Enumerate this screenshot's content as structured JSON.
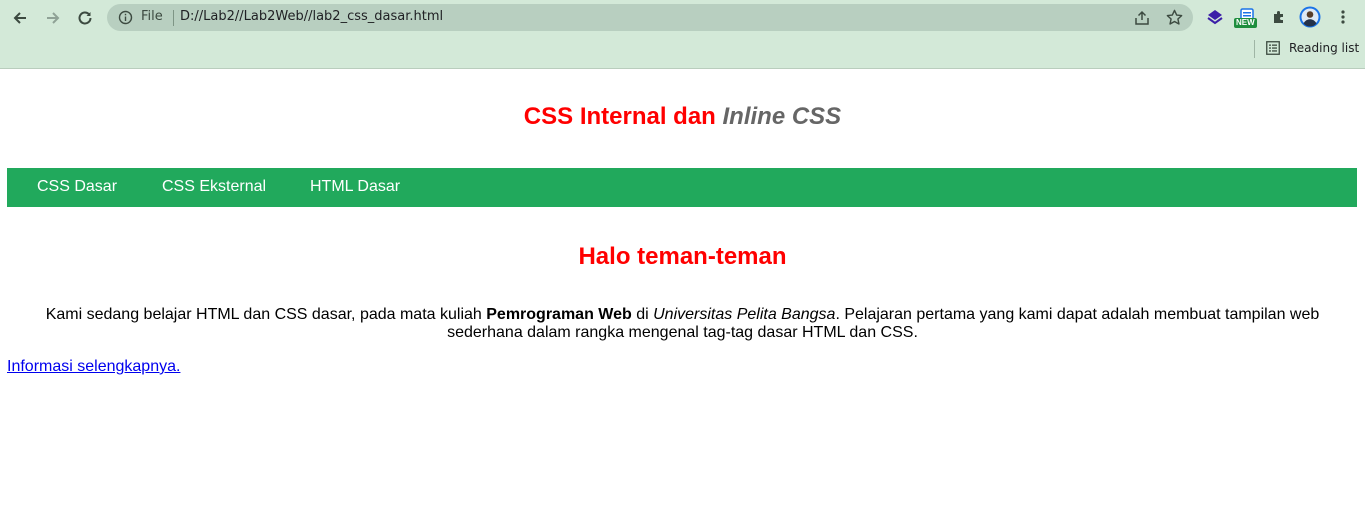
{
  "browser": {
    "address_scheme": "File",
    "address_url": "D://Lab2//Lab2Web//lab2_css_dasar.html",
    "new_badge": "NEW",
    "reading_list_label": "Reading list",
    "icons": [
      "back-icon",
      "forward-icon",
      "reload-icon",
      "info-icon",
      "share-icon",
      "star-icon",
      "extension-layers-icon",
      "extension-new-icon",
      "puzzle-icon",
      "profile-avatar",
      "more-icon",
      "reading-list-icon"
    ]
  },
  "page": {
    "title_part1": "CSS Internal dan ",
    "title_part2": "Inline CSS",
    "nav": [
      "CSS Dasar",
      "CSS Eksternal",
      "HTML Dasar"
    ],
    "heading": "Halo teman-teman",
    "paragraph": {
      "before_bold": "Kami sedang belajar HTML dan CSS dasar, pada mata kuliah ",
      "bold": "Pemrograman Web",
      "middle": " di ",
      "italic": "Universitas Pelita Bangsa",
      "after": ". Pelajaran pertama yang kami dapat adalah membuat tampilan web sederhana dalam rangka mengenal tag-tag dasar HTML dan CSS."
    },
    "link_text": "Informasi selengkapnya."
  },
  "colors": {
    "chrome_bg": "#d3e9d8",
    "omnibox_bg": "#b8cfc0",
    "title_red": "#ff0000",
    "title_gray": "#666666",
    "navbar_green": "#21a95c",
    "link_blue": "#0000ee"
  }
}
